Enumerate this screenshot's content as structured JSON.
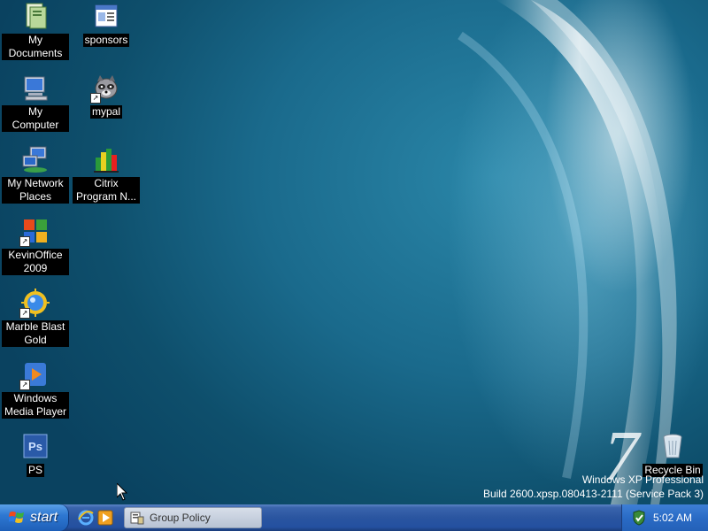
{
  "desktop": {
    "icons": [
      {
        "label": "My Documents",
        "icon": "my-documents-icon"
      },
      {
        "label": "sponsors",
        "icon": "document-icon"
      },
      {
        "label": "My Computer",
        "icon": "my-computer-icon"
      },
      {
        "label": "mypal",
        "icon": "raccoon-icon"
      },
      {
        "label": "My Network Places",
        "icon": "network-places-icon"
      },
      {
        "label": "Citrix Program N...",
        "icon": "citrix-icon"
      },
      {
        "label": "KevinOffice 2009",
        "icon": "office-icon"
      },
      {
        "label": "Marble Blast Gold",
        "icon": "marble-icon"
      },
      {
        "label": "Windows Media Player",
        "icon": "media-player-icon"
      },
      {
        "label": "PS",
        "icon": "photoshop-icon"
      },
      {
        "label": "Recycle Bin",
        "icon": "recycle-bin-icon"
      }
    ],
    "ps_glyph": "Ps",
    "brand_seven": "7",
    "version_line1": "Windows XP Professional",
    "version_line2": "Build 2600.xpsp.080413-2111 (Service Pack 3)"
  },
  "taskbar": {
    "start_label": "start",
    "quick_launch": [
      {
        "icon": "internet-explorer-icon"
      },
      {
        "icon": "media-player-icon"
      }
    ],
    "tasks": [
      {
        "label": "Group Policy",
        "icon": "group-policy-icon"
      }
    ],
    "tray": {
      "icon": "security-shield-icon",
      "clock": "5:02 AM"
    }
  },
  "colors": {
    "desktop_bg": "#1a6a8c",
    "taskbar": "#2a55a0",
    "start_button": "#2e78d2",
    "tray": "#2a6bc5"
  }
}
